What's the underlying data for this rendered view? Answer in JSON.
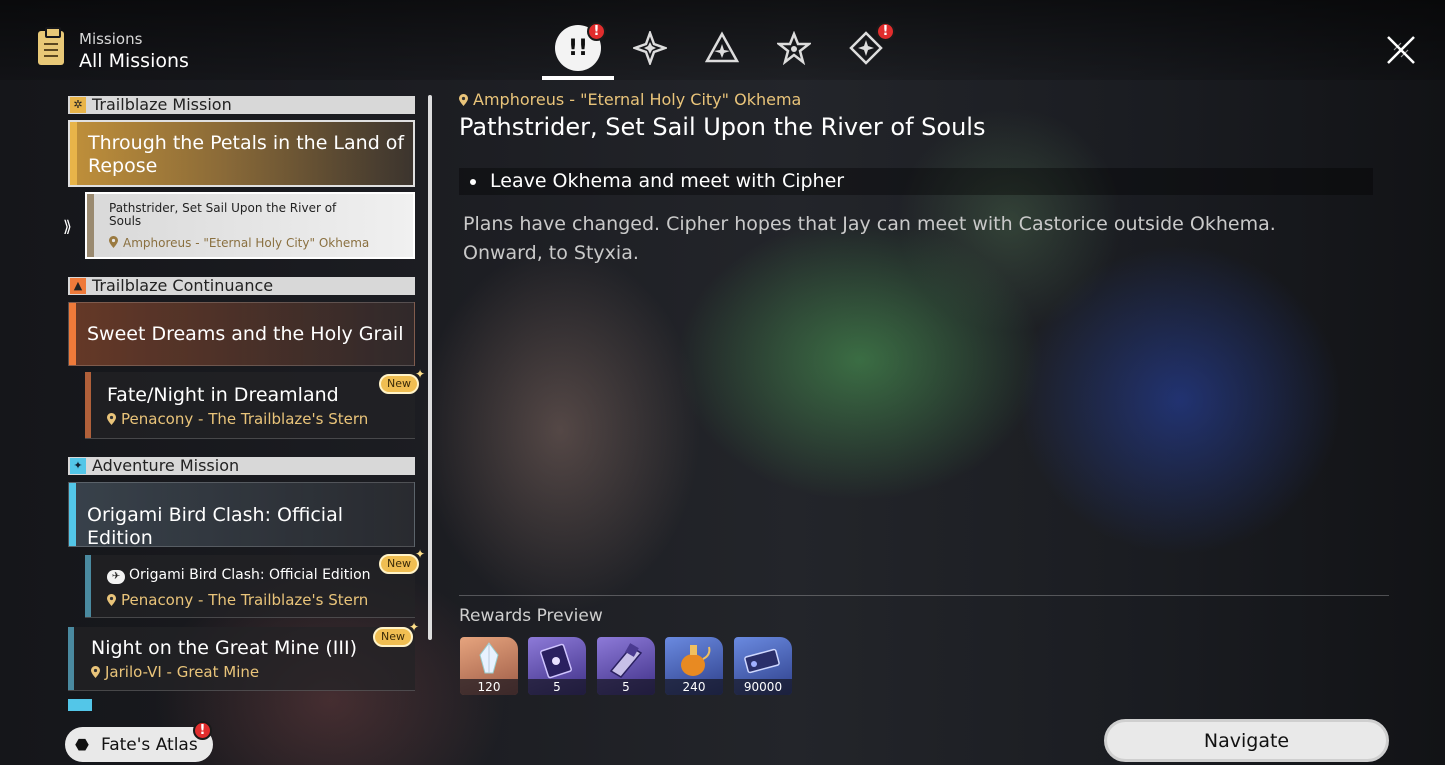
{
  "header": {
    "subtitle": "Missions",
    "title": "All Missions",
    "icon": "clipboard-icon"
  },
  "tabs": [
    {
      "icon": "exclamation-badge-icon",
      "active": true,
      "badge": "!"
    },
    {
      "icon": "sparkle-star-icon",
      "active": false
    },
    {
      "icon": "triangle-star-icon",
      "active": false
    },
    {
      "icon": "star-outline-icon",
      "active": false
    },
    {
      "icon": "diamond-star-icon",
      "active": false,
      "badge": "!"
    }
  ],
  "left": {
    "trailblaze_mission": {
      "header": "Trailblaze Mission",
      "card_title": "Through the Petals in the Land of Repose",
      "sub_title": "Pathstrider, Set Sail Upon the River of Souls",
      "sub_location": "Amphoreus - \"Eternal Holy City\" Okhema"
    },
    "trailblaze_continuance": {
      "header": "Trailblaze Continuance",
      "card_title": "Sweet Dreams and the Holy Grail",
      "sub_title": "Fate/Night in Dreamland",
      "sub_location": "Penacony - The Trailblaze's Stern",
      "badge": "New"
    },
    "adventure_mission": {
      "header": "Adventure Mission",
      "card_title": "Origami Bird Clash: Official Edition",
      "sub_title": "Origami Bird Clash: Official Edition",
      "sub_location": "Penacony - The Trailblaze's Stern",
      "badge": "New",
      "card2_title": "Night on the Great Mine (III)",
      "card2_location": "Jarilo-VI - Great Mine",
      "card2_badge": "New"
    },
    "atlas_button": {
      "label": "Fate's Atlas",
      "badge": "!"
    }
  },
  "detail": {
    "location": "Amphoreus - \"Eternal Holy City\" Okhema",
    "title": "Pathstrider, Set Sail Upon the River of Souls",
    "objective": "Leave Okhema and meet with Cipher",
    "description": "Plans have changed. Cipher hopes that Jay can meet with Castorice outside Okhema. Onward, to Styxia.",
    "rewards_label": "Rewards Preview",
    "rewards": [
      {
        "icon": "stellar-jade-icon",
        "count": "120",
        "color": "#c98366"
      },
      {
        "icon": "purple-book-icon",
        "count": "5",
        "color": "#6b5bb5"
      },
      {
        "icon": "purple-material-icon",
        "count": "5",
        "color": "#6b5bb5"
      },
      {
        "icon": "potion-icon",
        "count": "240",
        "color": "#4a63b8"
      },
      {
        "icon": "credit-icon",
        "count": "90000",
        "color": "#4a63b8"
      }
    ],
    "navigate_label": "Navigate"
  },
  "colors": {
    "trailblaze": "#e8b449",
    "continuance": "#ef7a3a",
    "adventure": "#53c6e8",
    "location_text": "#e9c47a",
    "badge_red": "#e12d2d"
  }
}
